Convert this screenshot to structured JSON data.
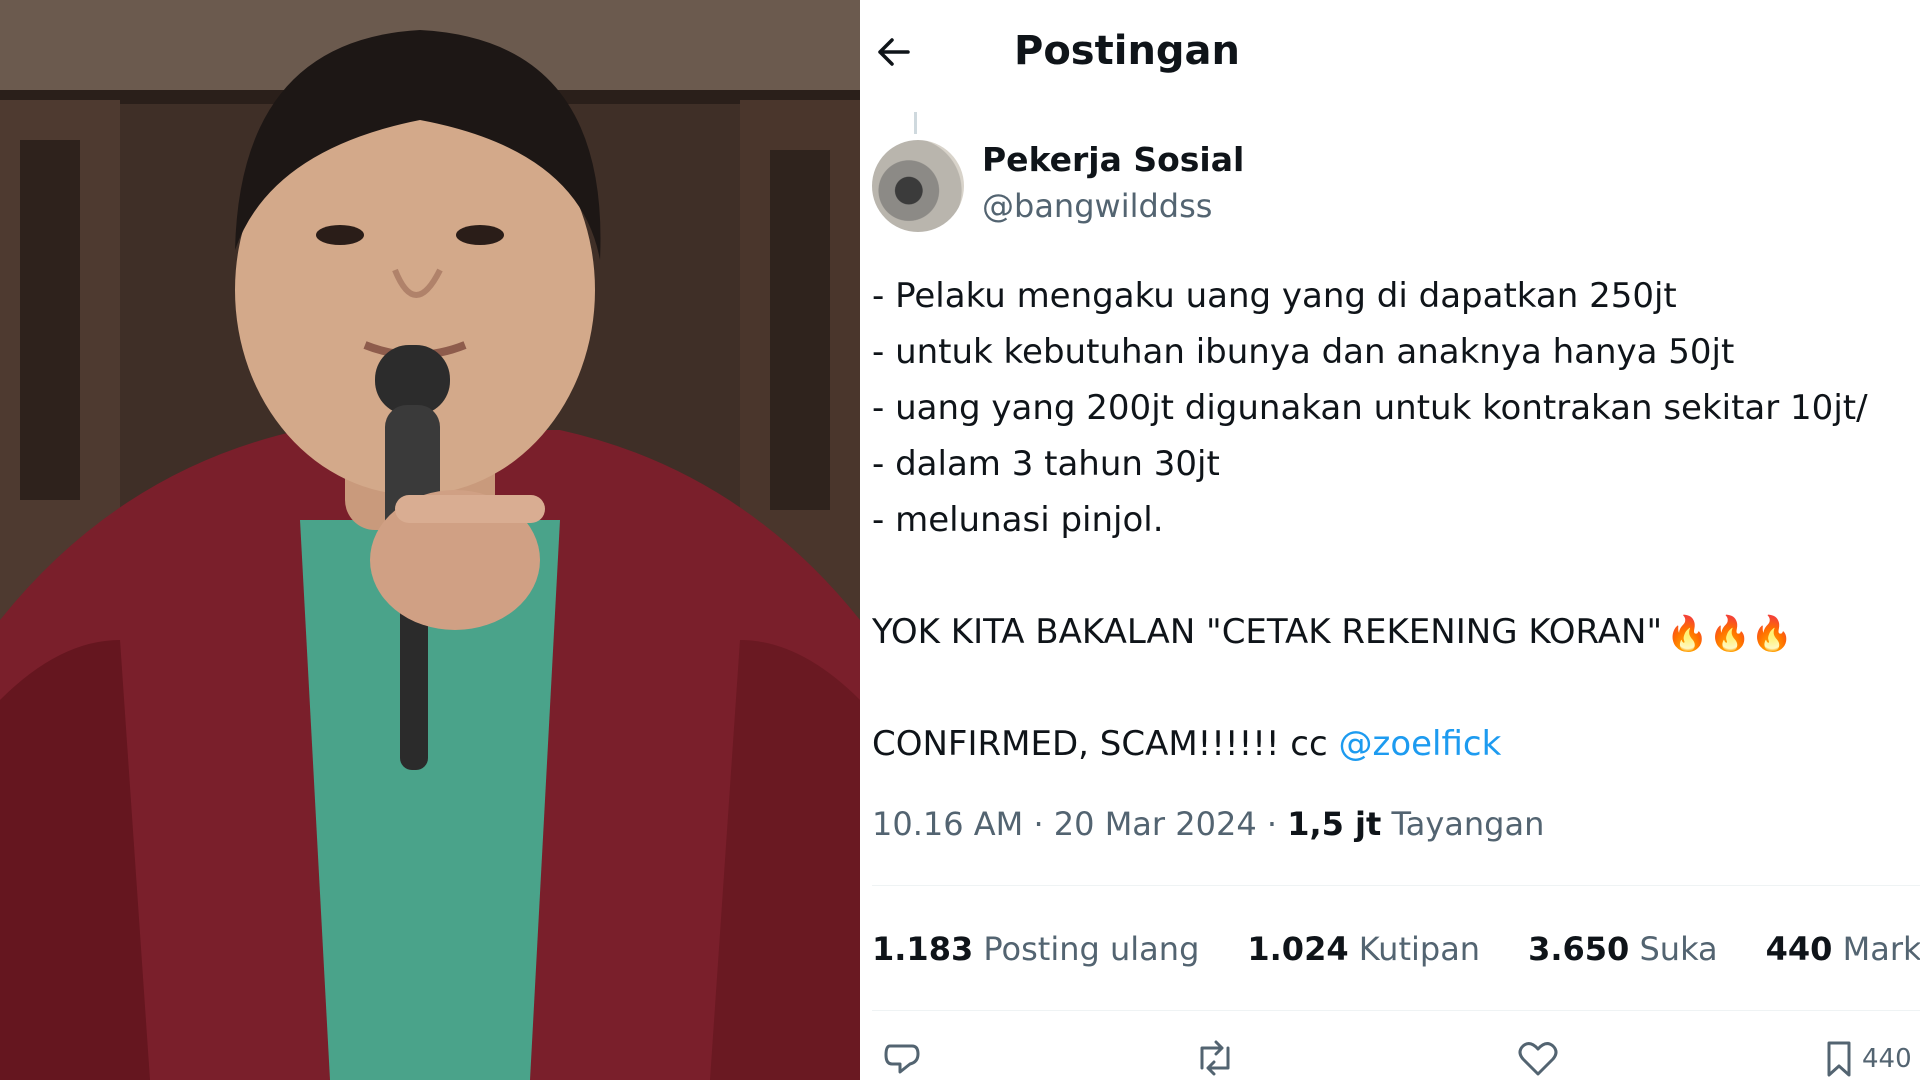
{
  "photo": {
    "description_icon": "person-speaking-with-microphone-photo",
    "jacket_color": "#7a1f2b",
    "shirt_color": "#4aa38a"
  },
  "header": {
    "title": "Postingan",
    "back_icon": "arrow-left-icon"
  },
  "tweet": {
    "author_name": "Pekerja Sosial",
    "author_handle": "@bangwilddss",
    "lines": [
      "- Pelaku mengaku uang yang di dapatkan 250jt",
      "- untuk kebutuhan ibunya dan anaknya hanya 50jt",
      "- uang yang 200jt digunakan untuk kontrakan sekitar 10jt/",
      "- dalam 3 tahun 30jt",
      "- melunasi pinjol."
    ],
    "shout": "YOK KITA BAKALAN \"CETAK REKENING KORAN\"",
    "shout_emoji": "🔥🔥🔥",
    "confirmed_text": "CONFIRMED, SCAM!!!!!! cc ",
    "mention": "@zoelfick",
    "time": "10.16 AM · 20 Mar 2024 · ",
    "views_count": "1,5 jt",
    "views_label": " Tayangan"
  },
  "stats": {
    "reposts_count": "1.183",
    "reposts_label": "Posting ulang",
    "quotes_count": "1.024",
    "quotes_label": "Kutipan",
    "likes_count": "3.650",
    "likes_label": "Suka",
    "bookmarks_count": "440",
    "bookmarks_label": "Markah"
  },
  "actions": {
    "bookmark_count": "440"
  },
  "colors": {
    "link": "#1d9bf0",
    "secondary_text": "#536471",
    "primary_text": "#0f1419"
  }
}
